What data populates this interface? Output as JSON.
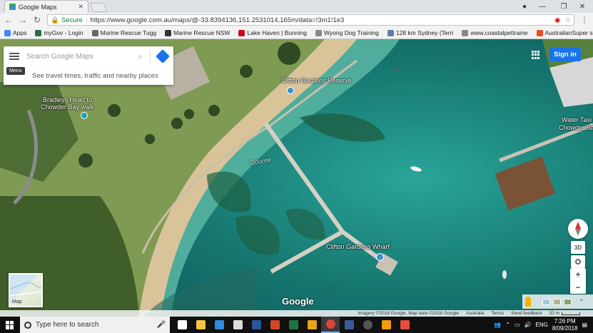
{
  "browser": {
    "tab_title": "Google Maps",
    "url_secure_label": "Secure",
    "url": "https://www.google.com.au/maps/@-33.8394136,151.2531014,165m/data=!3m1!1e3",
    "bookmarks": [
      {
        "label": "Apps",
        "color": "#4285f4"
      },
      {
        "label": "myGov - Login",
        "color": "#2d6a3f"
      },
      {
        "label": "Marine Rescue Tugg",
        "color": "#666666"
      },
      {
        "label": "Marine Rescue NSW",
        "color": "#333333"
      },
      {
        "label": "Lake Haven | Bunning",
        "color": "#d0021b"
      },
      {
        "label": "Wyong Dog Training",
        "color": "#888888"
      },
      {
        "label": "128 km Sydney (Terri",
        "color": "#5b7fa6"
      },
      {
        "label": "www.coastalpettraine",
        "color": "#888888"
      },
      {
        "label": "AustralianSuper sign",
        "color": "#e8501e"
      }
    ]
  },
  "maps": {
    "search_placeholder": "Search Google Maps",
    "suggestion": "See travel times, traffic and nearby places",
    "menu_tooltip": "Menu",
    "sign_in": "Sign in",
    "labels": [
      {
        "text": "Clifton Gardens Reserve"
      },
      {
        "text": "Bradleys Head to"
      },
      {
        "text": "Chowder Bay walk"
      },
      {
        "text": "Gooree"
      },
      {
        "text": "Clifton Gardens Wharf"
      },
      {
        "text": "Water Taxi"
      },
      {
        "text": "Chowder Bay"
      }
    ],
    "btn_3d": "3D",
    "logo": "Google",
    "thumbnail_label": "Map",
    "attribution": "Imagery ©2018 Google, Map data ©2018 Google",
    "country": "Australia",
    "terms": "Terms",
    "feedback": "Send feedback",
    "scale": "20 m"
  },
  "taskbar": {
    "search_placeholder": "Type here to search",
    "apps": [
      {
        "name": "task-view",
        "color": "#ffffff"
      },
      {
        "name": "file-explorer",
        "color": "#f4c542"
      },
      {
        "name": "edge",
        "color": "#2f8ae0"
      },
      {
        "name": "store",
        "color": "#dcdcdc"
      },
      {
        "name": "word",
        "color": "#2b579a"
      },
      {
        "name": "powerpoint",
        "color": "#d24726"
      },
      {
        "name": "excel",
        "color": "#217346"
      },
      {
        "name": "outlook",
        "color": "#e8a317"
      },
      {
        "name": "chrome",
        "color": "#db4437"
      },
      {
        "name": "facebook",
        "color": "#3b5998"
      },
      {
        "name": "media",
        "color": "#555555"
      },
      {
        "name": "app-orange",
        "color": "#f39c12"
      },
      {
        "name": "app-red",
        "color": "#e74c3c"
      }
    ],
    "language": "ENG",
    "time": "7:26 PM",
    "date": "8/09/2018"
  }
}
